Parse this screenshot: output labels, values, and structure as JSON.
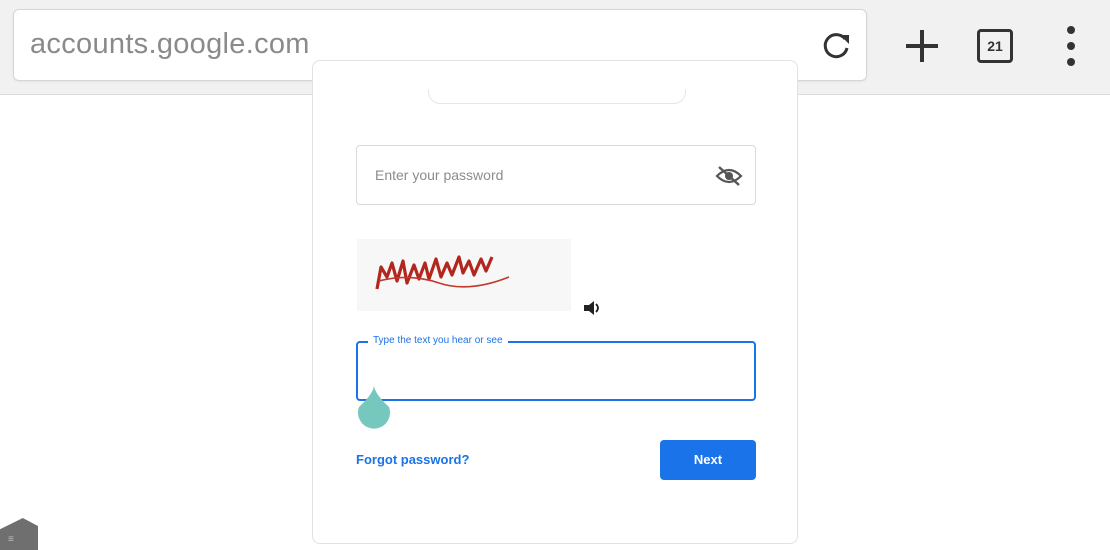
{
  "browser": {
    "url": "accounts.google.com",
    "tab_count": "21",
    "icons": {
      "reload": "reload-icon",
      "new_tab": "plus-icon",
      "tabs": "tab-switcher-icon",
      "menu": "more-vert-icon"
    }
  },
  "signin": {
    "password_placeholder": "Enter your password",
    "captcha_label": "Type the text you hear or see",
    "forgot_password": "Forgot password?",
    "next_button": "Next",
    "icons": {
      "visibility": "visibility-off-icon",
      "audio": "speaker-icon"
    }
  },
  "colors": {
    "accent": "#1a73e8",
    "captcha_text": "#b3261e",
    "touch_indicator": "#76c7bd"
  }
}
